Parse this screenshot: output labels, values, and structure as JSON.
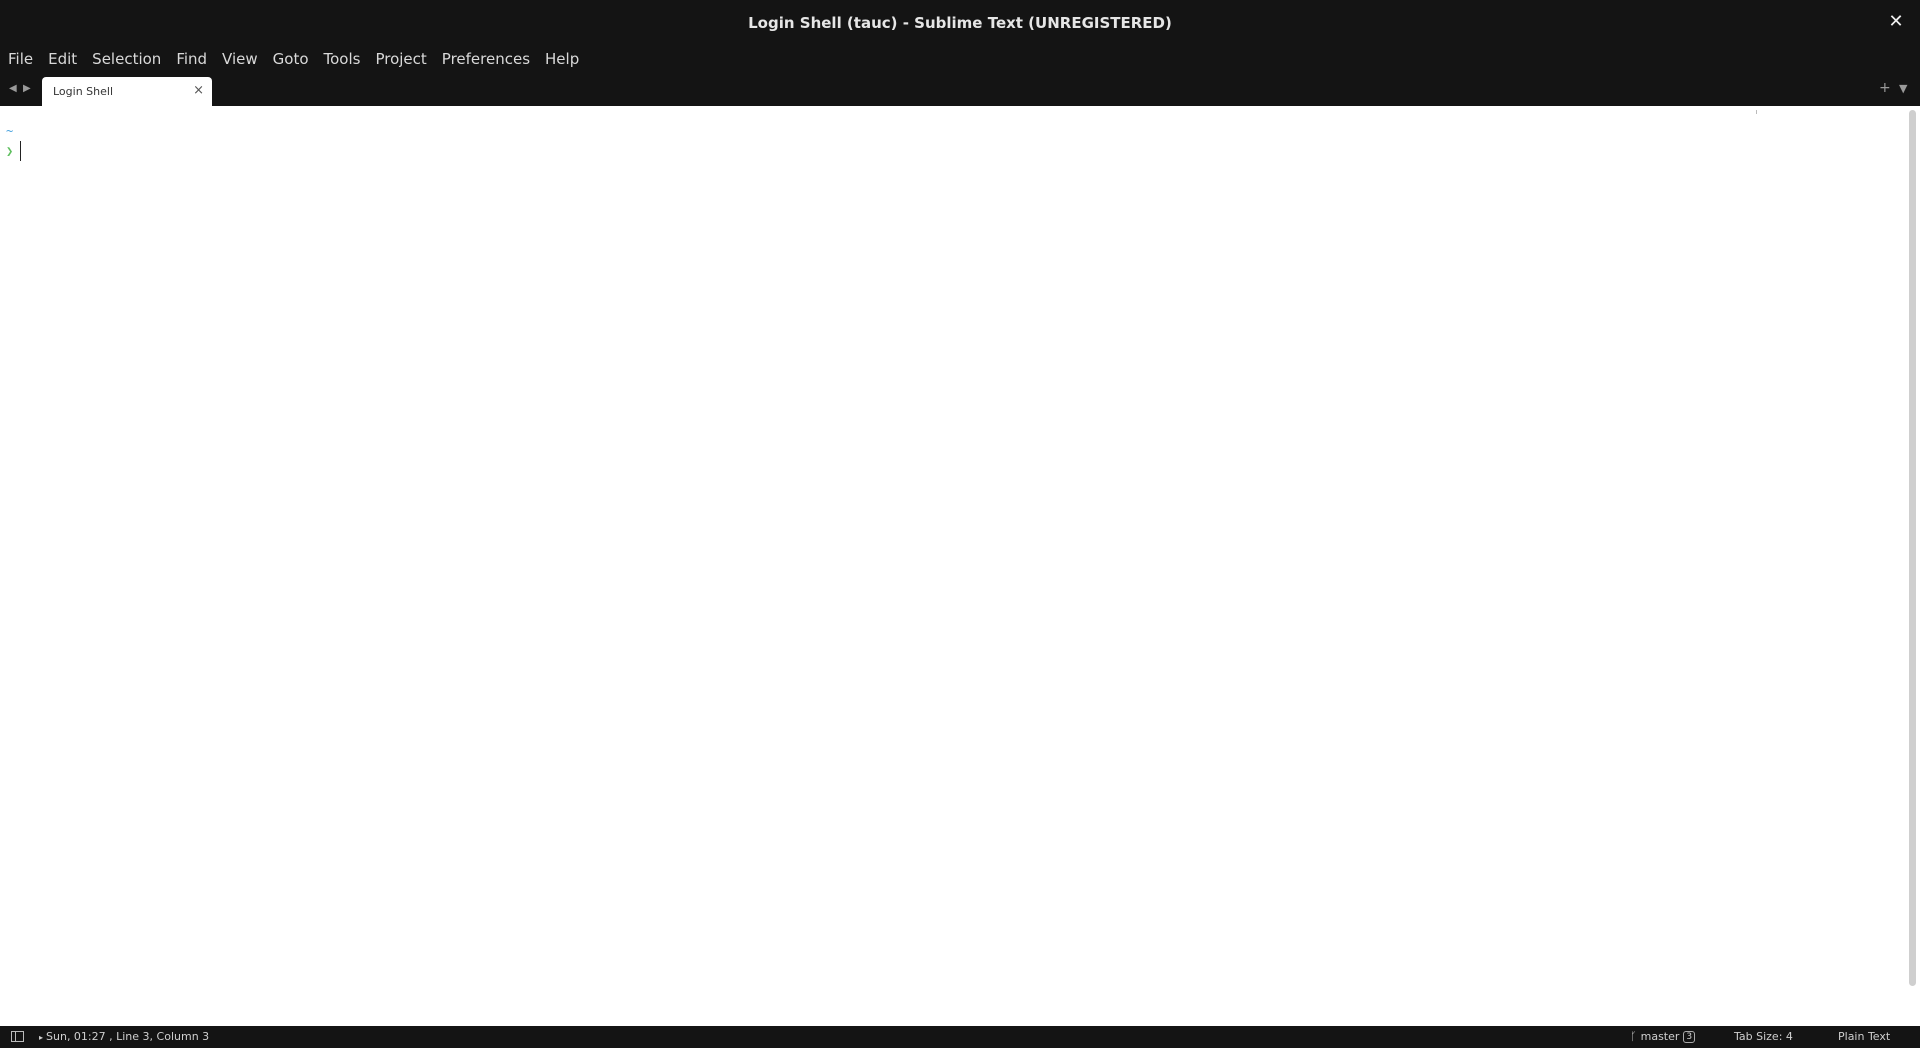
{
  "window": {
    "title": "Login Shell (tauc) - Sublime Text (UNREGISTERED)",
    "close_glyph": "✕"
  },
  "menu": {
    "items": [
      "File",
      "Edit",
      "Selection",
      "Find",
      "View",
      "Goto",
      "Tools",
      "Project",
      "Preferences",
      "Help"
    ]
  },
  "tabs": {
    "active_label": "Login Shell",
    "close_glyph": "×",
    "nav_prev_glyph": "◀",
    "nav_next_glyph": "▶",
    "new_tab_glyph": "+",
    "tab_list_glyph": "▼"
  },
  "editor": {
    "lines": [
      "~",
      "❯"
    ]
  },
  "status": {
    "left_text": "Sun, 01:27 , Line 3, Column 3",
    "arrow_glyph": "▸",
    "branch_icon": "ᚴ",
    "branch": "master",
    "branch_count": "3",
    "tab_size": "Tab Size: 4",
    "syntax": "Plain Text"
  },
  "colors": {
    "chrome_bg": "#141414",
    "editor_bg": "#ffffff",
    "prompt_tilde": "#4aa3df",
    "prompt_arrow": "#5fbf5f"
  }
}
